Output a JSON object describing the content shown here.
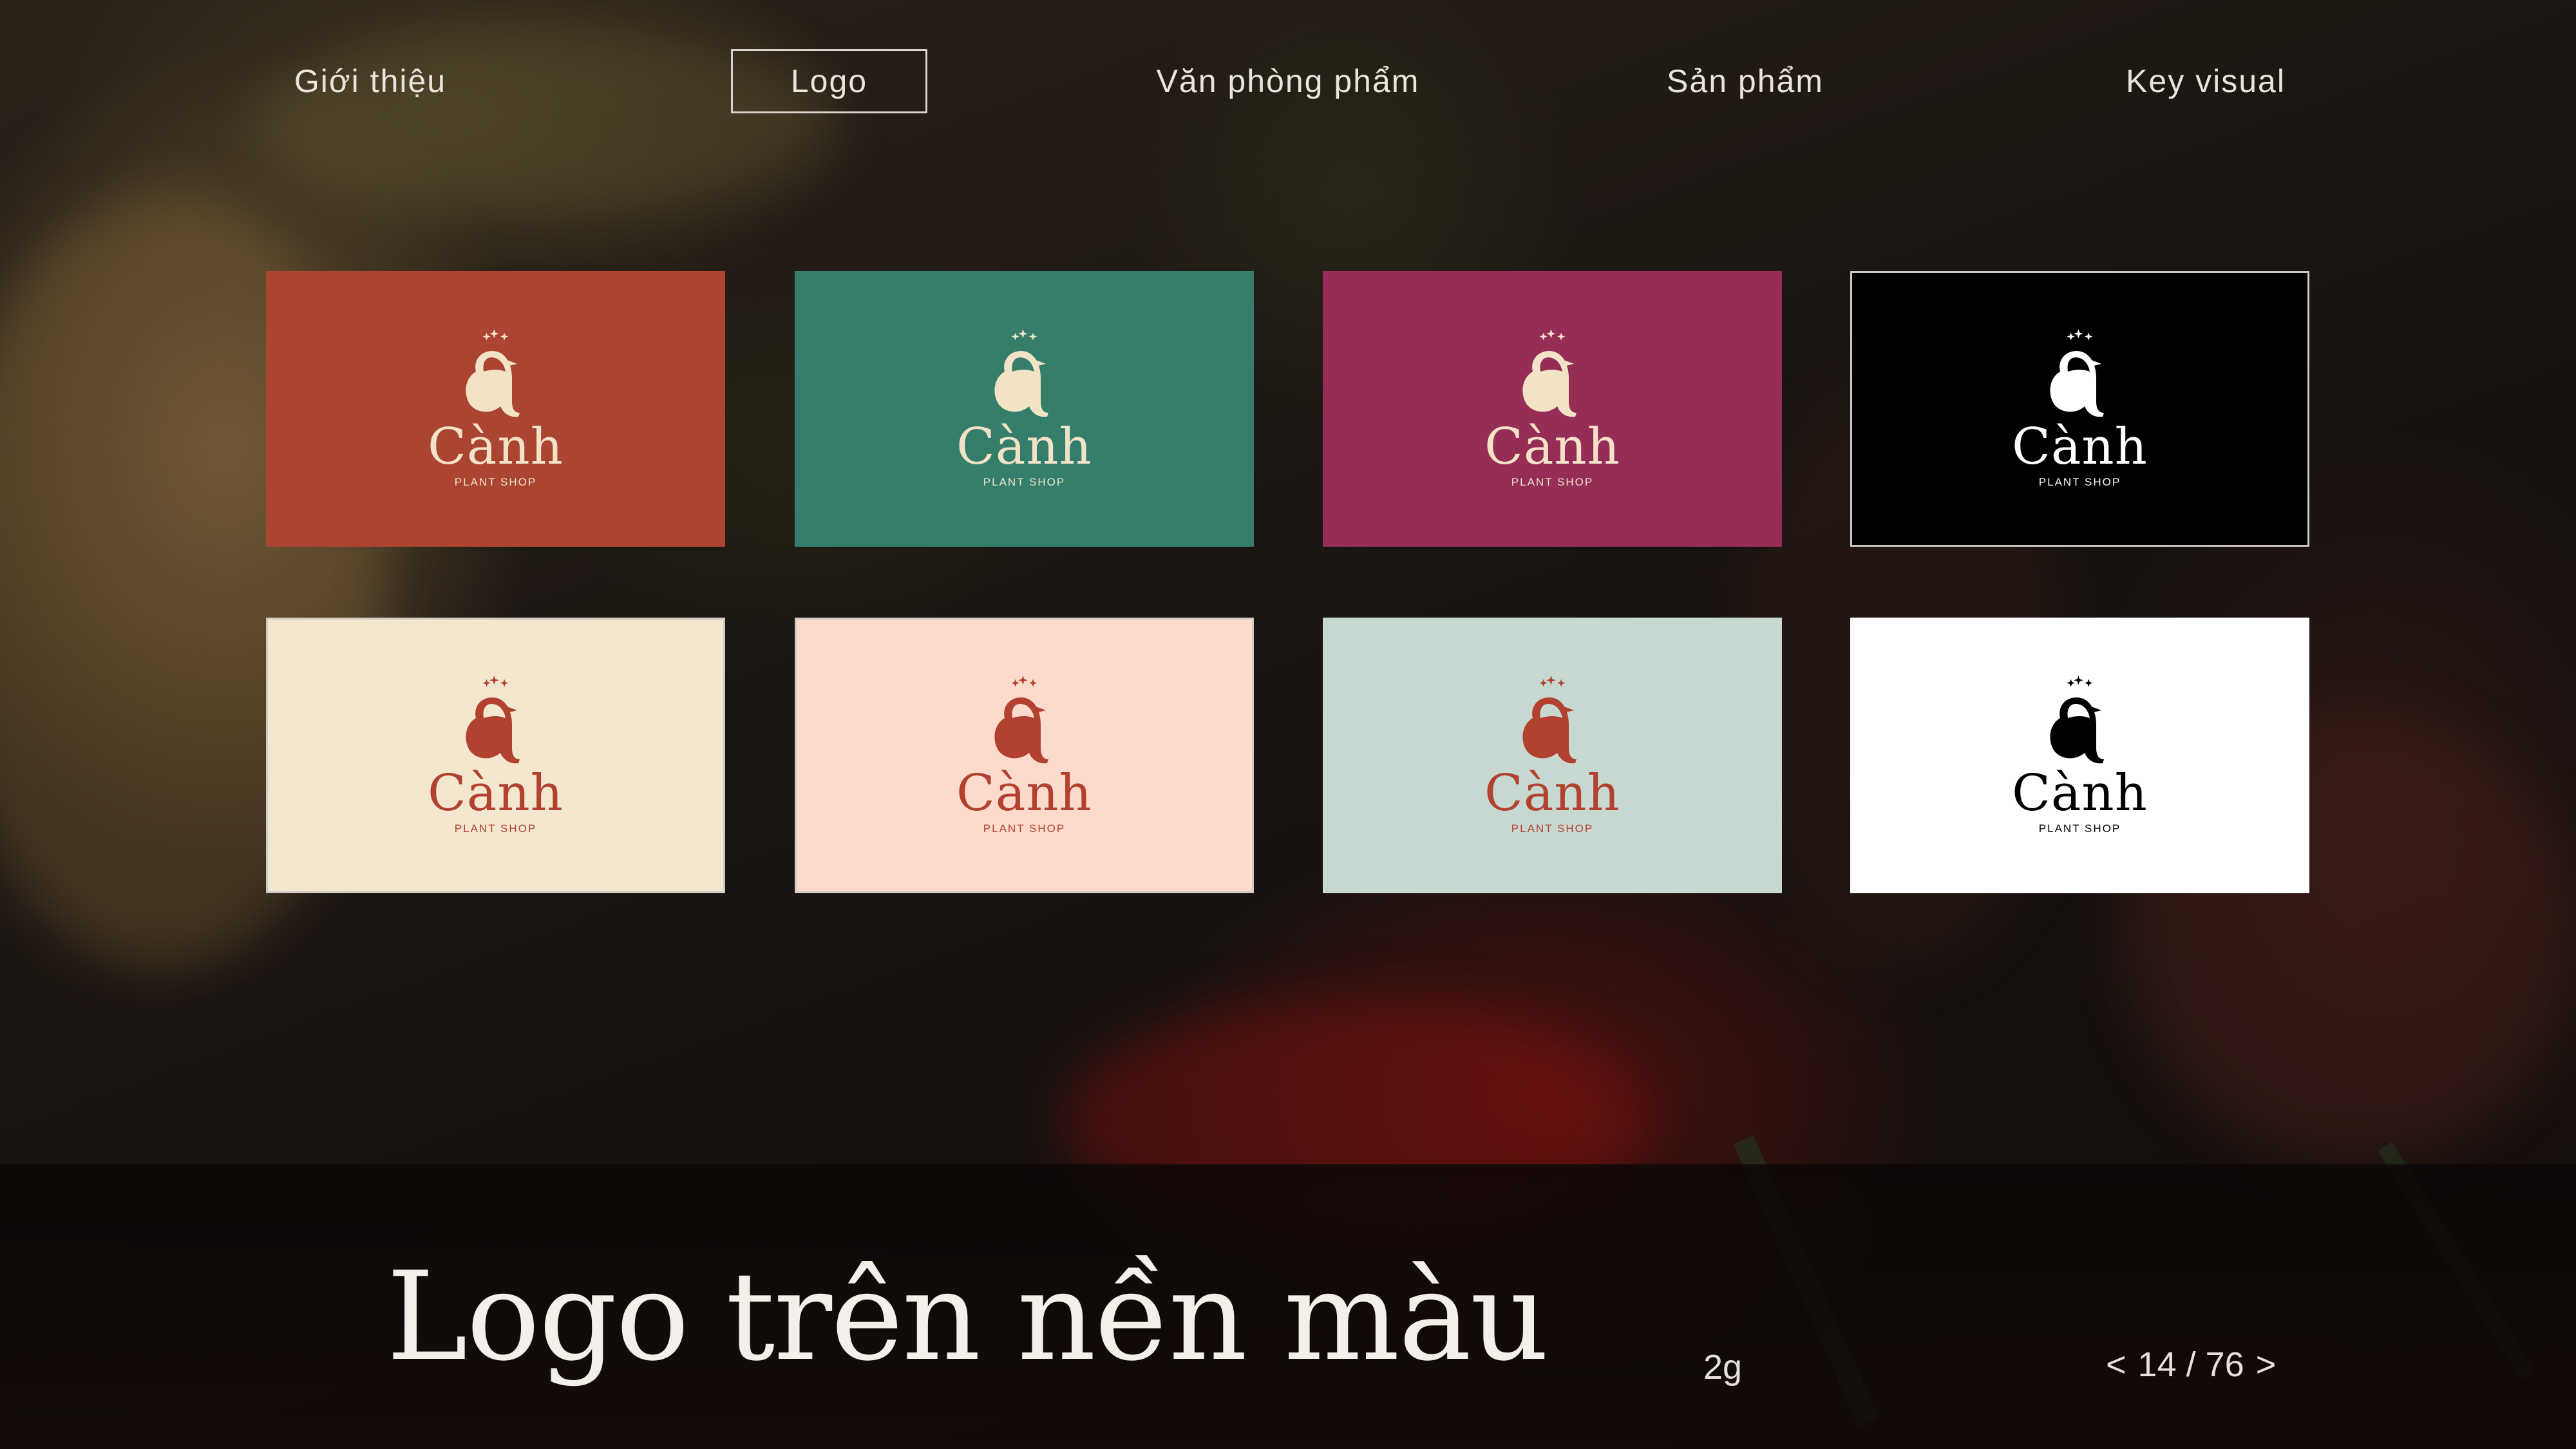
{
  "nav": {
    "items": [
      {
        "label": "Giới thiệu",
        "active": false
      },
      {
        "label": "Logo",
        "active": true
      },
      {
        "label": "Văn phòng phẩm",
        "active": false
      },
      {
        "label": "Sản phẩm",
        "active": false
      },
      {
        "label": "Key visual",
        "active": false
      }
    ]
  },
  "cards": [
    {
      "bg": "#ab4532",
      "fg": "#f2e3c6",
      "wordmark": "Cành",
      "tagline": "PLANT SHOP"
    },
    {
      "bg": "#347e6b",
      "fg": "#f2e3c6",
      "wordmark": "Cành",
      "tagline": "PLANT SHOP"
    },
    {
      "bg": "#962d57",
      "fg": "#f2e3c6",
      "wordmark": "Cành",
      "tagline": "PLANT SHOP"
    },
    {
      "bg": "#000000",
      "fg": "#ffffff",
      "wordmark": "Cành",
      "tagline": "PLANT SHOP"
    },
    {
      "bg": "#f3e8cf",
      "fg": "#b2412f",
      "wordmark": "Cành",
      "tagline": "PLANT SHOP"
    },
    {
      "bg": "#fcdacc",
      "fg": "#b2412f",
      "wordmark": "Cành",
      "tagline": "PLANT SHOP"
    },
    {
      "bg": "#c7d8d1",
      "fg": "#b2412f",
      "wordmark": "Cành",
      "tagline": "PLANT SHOP"
    },
    {
      "bg": "#ffffff",
      "fg": "#000000",
      "wordmark": "Cành",
      "tagline": "PLANT SHOP"
    }
  ],
  "footer": {
    "title": "Logo trên nền màu",
    "code": "2g",
    "pager": {
      "prev": "<",
      "text": "14 / 76",
      "next": ">"
    }
  },
  "icons": {
    "logo_mark": "bird-letter-a-icon",
    "prev": "chevron-left-icon",
    "next": "chevron-right-icon"
  }
}
